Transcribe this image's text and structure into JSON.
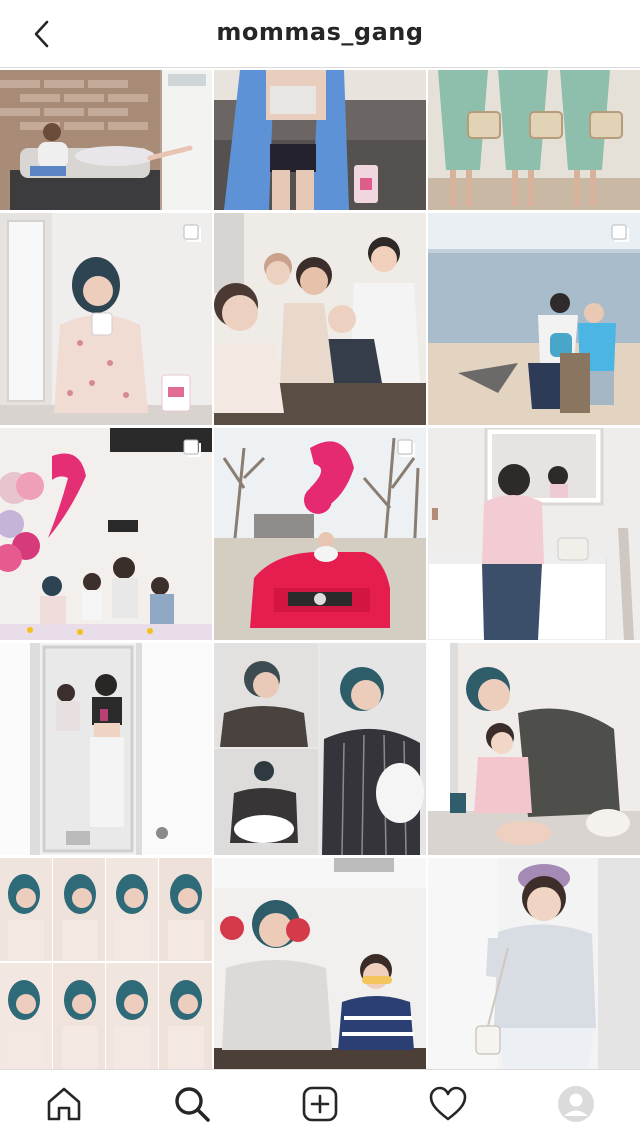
{
  "header": {
    "username": "mommas_gang",
    "back_icon": "chevron-left-icon"
  },
  "grid": {
    "columns": 3,
    "posts": [
      {
        "id": "post-1",
        "palette": [
          "#b9a79b",
          "#e8e4df",
          "#c5ced8",
          "#8c6d5c"
        ],
        "multi": false
      },
      {
        "id": "post-2",
        "palette": [
          "#e9e4dd",
          "#5b8fd1",
          "#d9d1c6",
          "#3d3c44"
        ],
        "multi": false
      },
      {
        "id": "post-3",
        "palette": [
          "#cdd9cf",
          "#e9e3d8",
          "#88b8a5",
          "#d6c5a7"
        ],
        "multi": false
      },
      {
        "id": "post-4",
        "palette": [
          "#f2f0ee",
          "#e6e2df",
          "#2d3f4a",
          "#f0d8d3"
        ],
        "multi": true
      },
      {
        "id": "post-5",
        "palette": [
          "#ece8e3",
          "#e9d3c8",
          "#47403d",
          "#f4f1ee"
        ],
        "multi": false
      },
      {
        "id": "post-6",
        "palette": [
          "#e5ecf1",
          "#b9cad6",
          "#e4d6c6",
          "#4db3e0"
        ],
        "multi": true
      },
      {
        "id": "post-7",
        "palette": [
          "#f4f0ee",
          "#e35c94",
          "#4a5a6f",
          "#c9b4d8"
        ],
        "multi": true
      },
      {
        "id": "post-8",
        "palette": [
          "#eef1f3",
          "#d8d1c6",
          "#e0245e",
          "#ee3f7f"
        ],
        "multi": true
      },
      {
        "id": "post-9",
        "palette": [
          "#f1eeec",
          "#e8c9cf",
          "#37495e",
          "#ffffff"
        ],
        "multi": false
      },
      {
        "id": "post-10",
        "palette": [
          "#ececec",
          "#ffffff",
          "#1d1d1f",
          "#eeeeee"
        ],
        "multi": false
      },
      {
        "id": "post-11",
        "palette": [
          "#e9e6e4",
          "#3b3a3d",
          "#ffffff",
          "#496b79"
        ],
        "multi": false
      },
      {
        "id": "post-12",
        "palette": [
          "#efece9",
          "#4e4f4a",
          "#f2c9cd",
          "#2f5d6c"
        ],
        "multi": false
      },
      {
        "id": "post-13",
        "palette": [
          "#f3ece8",
          "#356d79",
          "#f1ded6",
          "#e8c1bd"
        ],
        "multi": false
      },
      {
        "id": "post-14",
        "palette": [
          "#f2f0ee",
          "#dad8d5",
          "#356a78",
          "#2c3e74"
        ],
        "multi": false
      },
      {
        "id": "post-15",
        "palette": [
          "#f1f1f1",
          "#d9dde3",
          "#a38ab4",
          "#eee8e6"
        ],
        "multi": false
      }
    ]
  },
  "tabbar": {
    "tabs": [
      {
        "name": "home-icon",
        "active": false
      },
      {
        "name": "search-icon",
        "active": true
      },
      {
        "name": "new-post-icon",
        "active": false
      },
      {
        "name": "heart-icon",
        "active": false
      },
      {
        "name": "profile-avatar-icon",
        "active": false
      }
    ]
  },
  "colors": {
    "text": "#262626",
    "border": "#dbdbdb",
    "background": "#ffffff"
  }
}
